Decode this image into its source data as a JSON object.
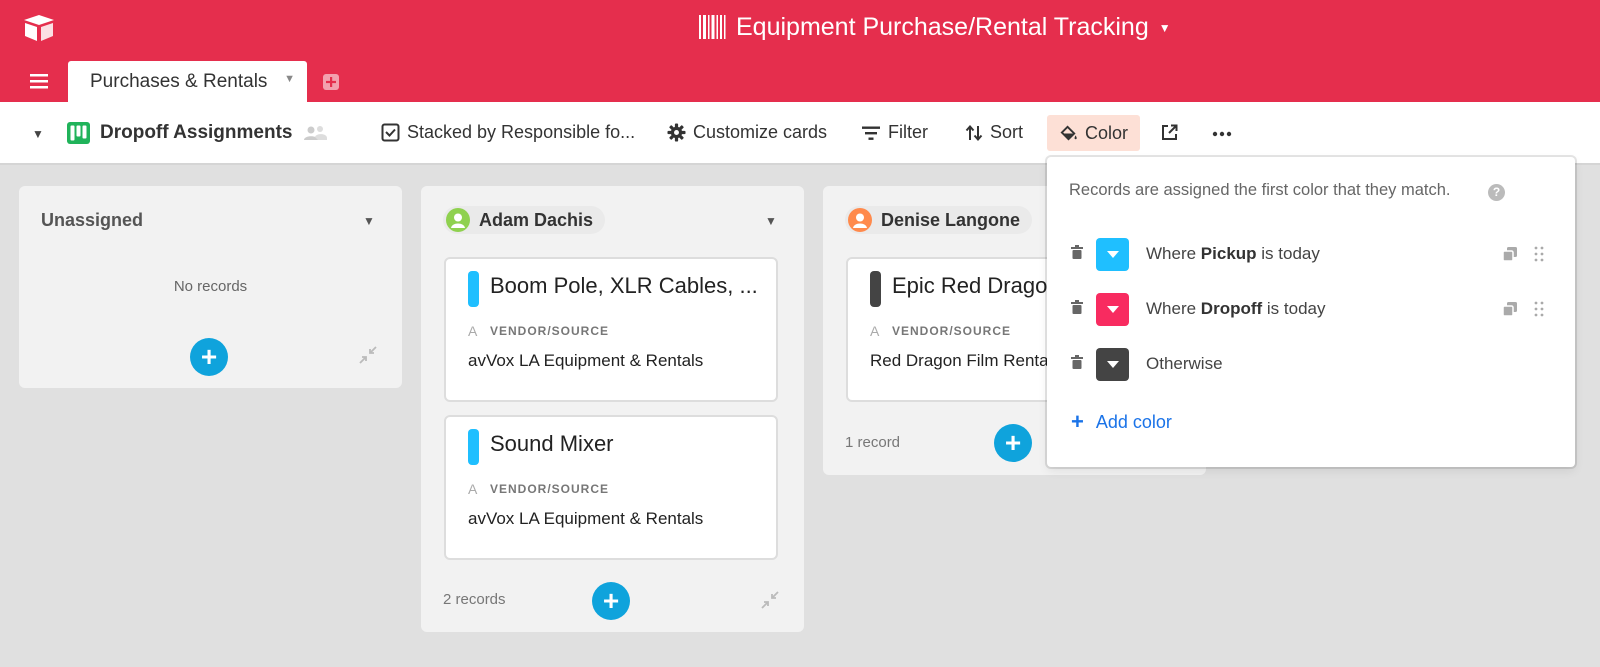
{
  "app": {
    "base_title": "Equipment Purchase/Rental Tracking",
    "brand_color": "#e52e4d"
  },
  "tabs": [
    {
      "label": "Purchases & Rentals",
      "active": true
    }
  ],
  "toolbar": {
    "view_name": "Dropoff Assignments",
    "stacked_label": "Stacked by Responsible fo...",
    "customize_label": "Customize cards",
    "filter_label": "Filter",
    "sort_label": "Sort",
    "color_label": "Color"
  },
  "board": {
    "columns": [
      {
        "title": "Unassigned",
        "empty_text": "No records"
      },
      {
        "title": "Adam Dachis",
        "avatar_color": "#8fd14f",
        "count_text": "2 records",
        "cards": [
          {
            "title": "Boom Pole, XLR Cables, ...",
            "color": "#1fbfff",
            "field_label": "VENDOR/SOURCE",
            "field_value": "avVox LA Equipment & Rentals"
          },
          {
            "title": "Sound Mixer",
            "color": "#1fbfff",
            "field_label": "VENDOR/SOURCE",
            "field_value": "avVox LA Equipment & Rentals"
          }
        ]
      },
      {
        "title": "Denise Langone",
        "avatar_color": "#ff8a4c",
        "count_text": "1 record",
        "cards": [
          {
            "title": "Epic Red Dragon",
            "color": "#444444",
            "field_label": "VENDOR/SOURCE",
            "field_value": "Red Dragon Film Renta"
          }
        ]
      }
    ]
  },
  "color_popover": {
    "info": "Records are assigned the first color that they match.",
    "rules": [
      {
        "prefix": "Where ",
        "field": "Pickup",
        "suffix": " is today",
        "color": "#1fbfff"
      },
      {
        "prefix": "Where ",
        "field": "Dropoff",
        "suffix": " is today",
        "color": "#f82b60"
      },
      {
        "prefix": "",
        "field": "",
        "suffix": "Otherwise",
        "color": "#444444"
      }
    ],
    "add_label": "Add color"
  }
}
